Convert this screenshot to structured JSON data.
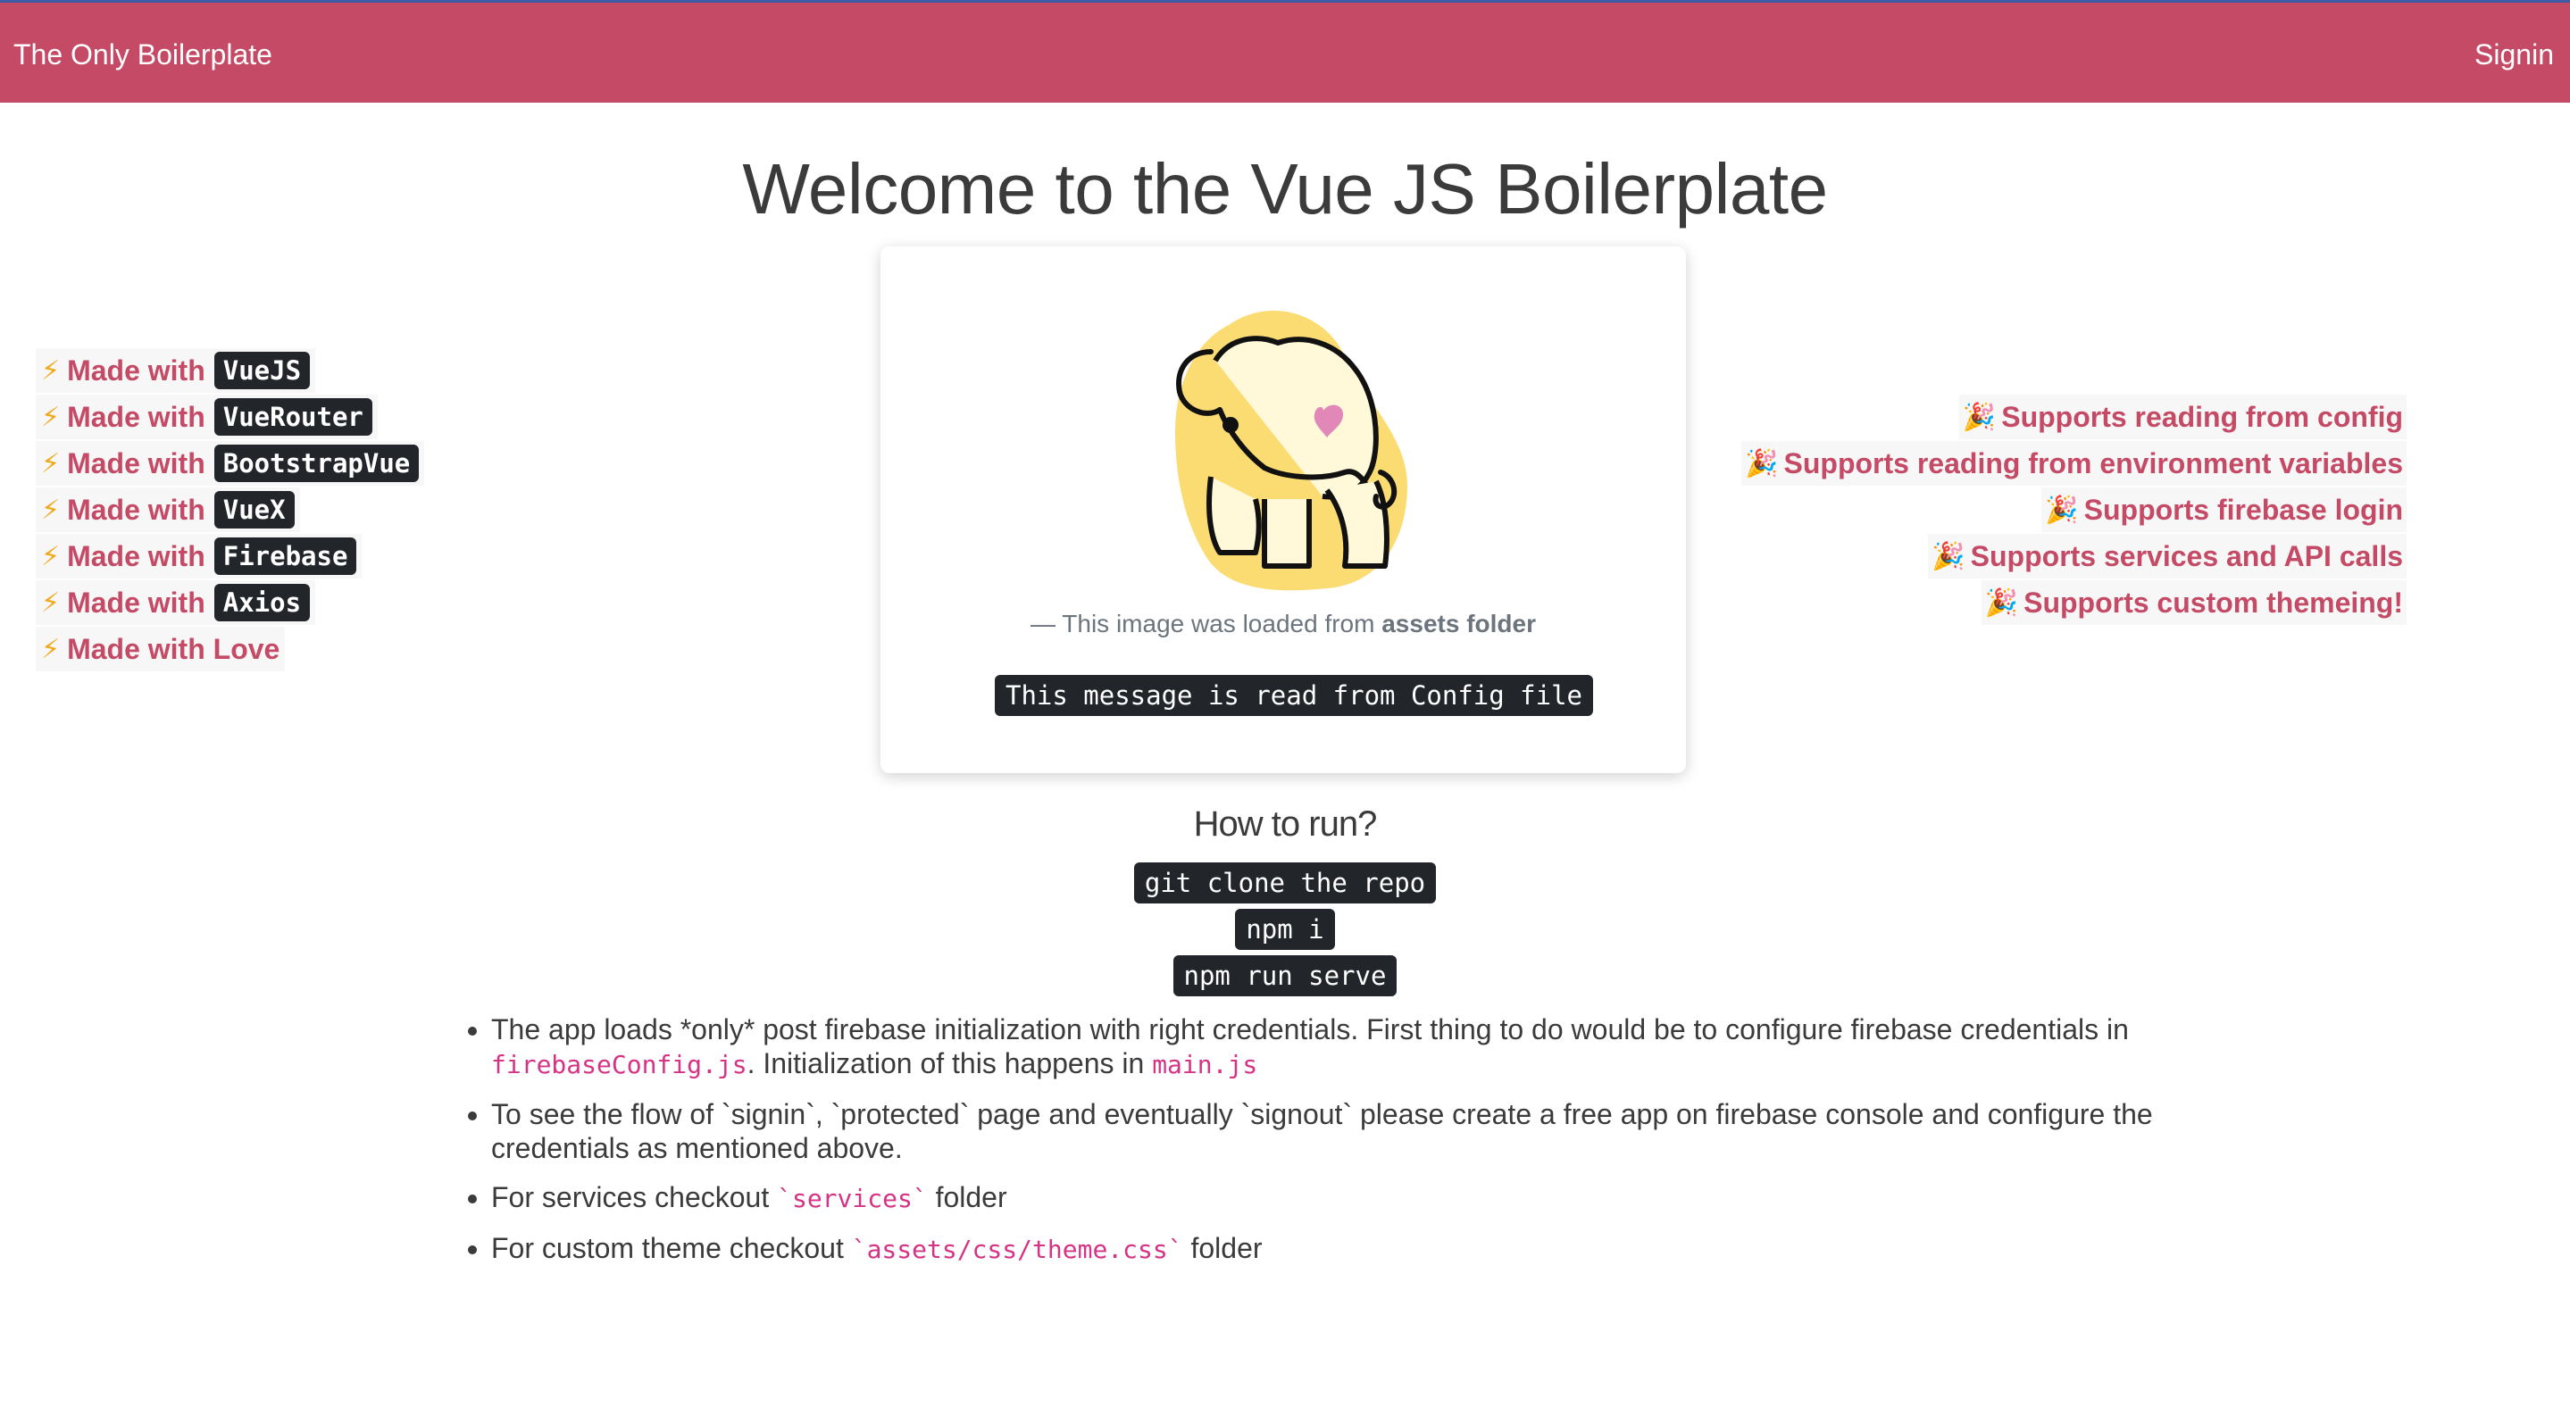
{
  "navbar": {
    "brand": "The Only Boilerplate",
    "signin": "Signin",
    "color": "#c44a66"
  },
  "page_title": "Welcome to the Vue JS Boilerplate",
  "made_with": {
    "icon": "lightning-bolt-icon",
    "items": [
      {
        "label": "Made with",
        "tech": "VueJS"
      },
      {
        "label": "Made with",
        "tech": "VueRouter"
      },
      {
        "label": "Made with",
        "tech": "BootstrapVue"
      },
      {
        "label": "Made with",
        "tech": "VueX"
      },
      {
        "label": "Made with",
        "tech": "Firebase"
      },
      {
        "label": "Made with",
        "tech": "Axios"
      },
      {
        "label": "Made with Love",
        "tech": ""
      }
    ]
  },
  "supports": {
    "icon": "party-popper-icon",
    "items": [
      "Supports reading from config",
      "Supports reading from environment variables",
      "Supports firebase login",
      "Supports services and API calls",
      "Supports custom themeing!"
    ]
  },
  "card": {
    "image_icon": "elephant-logo",
    "caption_prefix": "— This image was loaded from",
    "caption_bold": "assets folder",
    "config_message": "This message is read from Config file"
  },
  "how_to_run": {
    "title": "How to run?",
    "commands": [
      "git clone the repo",
      "npm i",
      "npm run serve"
    ]
  },
  "notes": {
    "n1_a": "The app loads *only* post firebase initialization with right credentials. First thing to do would be to configure firebase credentials in",
    "n1_code1": "firebaseConfig.js",
    "n1_b": ". Initialization of this happens in",
    "n1_code2": "main.js",
    "n2": "To see the flow of `signin`, `protected` page and eventually `signout` please create a free app on firebase console and configure the credentials as mentioned above.",
    "n3_a": "For services checkout",
    "n3_code": "`services`",
    "n3_b": "folder",
    "n4_a": "For custom theme checkout",
    "n4_code": "`assets/css/theme.css`",
    "n4_b": "folder"
  }
}
